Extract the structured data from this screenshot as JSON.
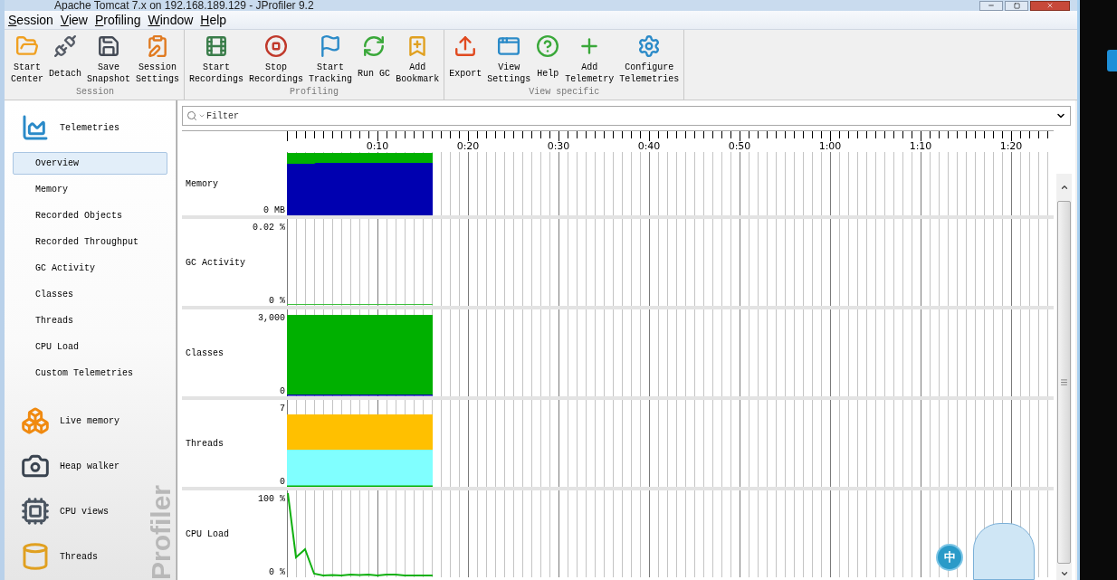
{
  "window": {
    "title": "Apache Tomcat 7.x on 192.168.189.129 - JProfiler 9.2"
  },
  "menu": [
    "Session",
    "View",
    "Profiling",
    "Window",
    "Help"
  ],
  "toolbar": [
    {
      "label": "Session",
      "buttons": [
        {
          "label": "Start\nCenter"
        },
        {
          "label": "Detach"
        },
        {
          "label": "Save\nSnapshot"
        },
        {
          "label": "Session\nSettings"
        }
      ]
    },
    {
      "label": "Profiling",
      "buttons": [
        {
          "label": "Start\nRecordings"
        },
        {
          "label": "Stop\nRecordings"
        },
        {
          "label": "Start\nTracking"
        },
        {
          "label": "Run GC"
        },
        {
          "label": "Add\nBookmark"
        }
      ]
    },
    {
      "label": "View specific",
      "buttons": [
        {
          "label": "Export"
        },
        {
          "label": "View\nSettings"
        },
        {
          "label": "Help"
        },
        {
          "label": "Add\nTelemetry"
        },
        {
          "label": "Configure\nTelemetries"
        }
      ]
    }
  ],
  "sidebar": {
    "brand": "Profiler",
    "sections": [
      {
        "label": "Telemetries",
        "children": [
          {
            "label": "Overview",
            "selected": true
          },
          {
            "label": "Memory",
            "selected": false
          },
          {
            "label": "Recorded Objects",
            "selected": false
          },
          {
            "label": "Recorded Throughput",
            "selected": false
          },
          {
            "label": "GC Activity",
            "selected": false
          },
          {
            "label": "Classes",
            "selected": false
          },
          {
            "label": "Threads",
            "selected": false
          },
          {
            "label": "CPU Load",
            "selected": false
          },
          {
            "label": "Custom Telemetries",
            "selected": false
          }
        ]
      },
      {
        "label": "Live memory"
      },
      {
        "label": "Heap walker"
      },
      {
        "label": "CPU views"
      },
      {
        "label": "Threads"
      }
    ]
  },
  "filter": {
    "placeholder": "Filter"
  },
  "timeline": {
    "ticks": [
      "0:10",
      "0:20",
      "0:30",
      "0:40",
      "0:50",
      "1:00",
      "1:10",
      "1:20"
    ],
    "rows": [
      {
        "label": "Memory",
        "kind": "memory",
        "y_min": "0 MB"
      },
      {
        "label": "GC Activity",
        "kind": "gc",
        "y_max": "0.02 %",
        "y_min": "0 %"
      },
      {
        "label": "Classes",
        "kind": "classes",
        "y_max": "3,000",
        "y_min": "0"
      },
      {
        "label": "Threads",
        "kind": "threads",
        "y_max": "7",
        "y_min": "0"
      },
      {
        "label": "CPU Load",
        "kind": "cpu",
        "y_max": "100 %",
        "y_min": "0 %"
      }
    ]
  },
  "ime": {
    "label": "中"
  }
}
